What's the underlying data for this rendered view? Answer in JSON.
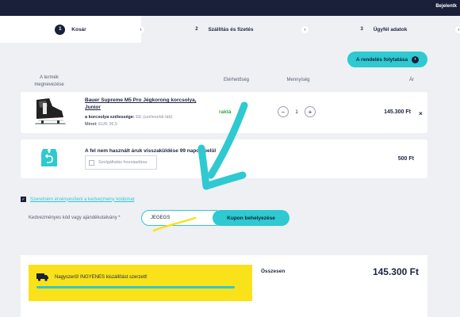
{
  "header": {
    "login_label": "Bejelentk"
  },
  "steps": [
    {
      "number": "1",
      "label": "Kosár"
    },
    {
      "number": "2",
      "label": "Szállítás és fizetés"
    },
    {
      "number": "3",
      "label": "Ügyfél adatok"
    }
  ],
  "actions": {
    "continue_label": "A rendelés folytatása"
  },
  "columns": {
    "product": "A termék megnevezése",
    "availability": "Elérhetőség",
    "quantity": "Mennyiség",
    "price": "Ár"
  },
  "cart_item": {
    "name": "Bauer Supreme M5 Pro Jégkorong korcsolya, Junior",
    "width_label": "a korcsolya szélessége:",
    "width_value": "EE (szélesebb láb)",
    "size_label": "Méret:",
    "size_value": "EUR 36,5",
    "stock": "raktá",
    "quantity": "1",
    "minus": "−",
    "plus": "+",
    "price": "145.300 Ft",
    "remove": "×"
  },
  "return_service": {
    "title": "A fel nem használt áruk visszaküldése 99 napon belül",
    "add_label": "Szolgáltatás hozzáadása",
    "price": "500 Ft"
  },
  "coupon": {
    "toggle_label": "Szeretném érvényesíteni a kedvezmény kódomat",
    "field_label": "Kedvezményes kód vagy ajándékutalvány *",
    "value": "JEGEGS",
    "apply_label": "Kupon behelyezése"
  },
  "summary": {
    "shipping_text": "Nagyszerű! INGYENES kiszállítást szerzett!",
    "shipping_progress": 1.0,
    "total_label": "Összesen",
    "total_value": "145.300 Ft"
  },
  "colors": {
    "accent": "#2ec9d1",
    "dark": "#1a1f3a",
    "promo": "#f9e21a",
    "stock": "#2fa84f"
  }
}
